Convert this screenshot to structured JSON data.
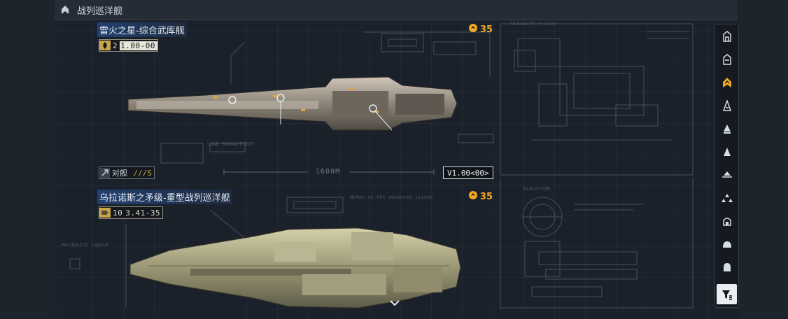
{
  "header": {
    "title": "战列巡洋舰",
    "icon": "rank-chevron-icon"
  },
  "ships": [
    {
      "name": "雷火之星-综合武库舰",
      "stat_icon": "weapon-flame-icon",
      "stat_prefix": "2",
      "stat_value": "1.00-00",
      "cost": "35",
      "cost_icon": "command-point-icon",
      "role": "对舰",
      "class_mark": "///S",
      "scale": "1600M",
      "version": "V1.00<00>"
    },
    {
      "name": "乌拉诺斯之矛级-重型战列巡洋舰",
      "stat_icon": "thruster-icon",
      "stat_prefix": "10",
      "stat_value": "3.41-35",
      "cost": "35",
      "cost_icon": "command-point-icon"
    }
  ],
  "rail": {
    "items": [
      {
        "icon": "station-icon"
      },
      {
        "icon": "carrier-icon"
      },
      {
        "icon": "battlecruiser-icon",
        "active": true
      },
      {
        "icon": "destroyer-icon"
      },
      {
        "icon": "cruiser-icon"
      },
      {
        "icon": "frigate-icon"
      },
      {
        "icon": "corvette-icon"
      },
      {
        "icon": "fighter-icon"
      },
      {
        "icon": "auxiliary-icon"
      },
      {
        "icon": "dome-icon"
      },
      {
        "icon": "dome-small-icon"
      },
      {
        "icon": "filter-icon"
      }
    ]
  },
  "colors": {
    "accent": "#f0a821",
    "background": "#1b212a",
    "title_highlight": "#2a5aa8"
  }
}
